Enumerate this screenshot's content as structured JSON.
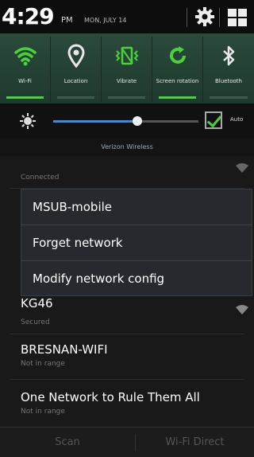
{
  "status": {
    "time": "4:29",
    "ampm": "PM",
    "date": "MON, JULY 14"
  },
  "toggles": [
    {
      "label": "Wi-Fi",
      "icon": "wifi-icon",
      "on": true
    },
    {
      "label": "Location",
      "icon": "location-icon",
      "on": false
    },
    {
      "label": "Vibrate",
      "icon": "vibrate-icon",
      "on": false
    },
    {
      "label": "Screen rotation",
      "icon": "rotation-icon",
      "on": true
    },
    {
      "label": "Bluetooth",
      "icon": "bluetooth-icon",
      "on": false
    }
  ],
  "brightness": {
    "level": 0.58,
    "auto_label": "Auto",
    "auto_checked": true
  },
  "carrier": "Verizon Wireless",
  "networks": [
    {
      "name": "",
      "status": "Connected"
    },
    {
      "name": "KG46",
      "status": "Secured"
    },
    {
      "name": "BRESNAN-WIFI",
      "status": "Not in range"
    },
    {
      "name": "One Network to Rule Them All",
      "status": "Not in range"
    }
  ],
  "menu": {
    "title": "MSUB-mobile",
    "items": [
      "Forget network",
      "Modify network config"
    ]
  },
  "bottom": {
    "scan_label": "Scan",
    "direct_label": "Wi-Fi Direct"
  },
  "colors": {
    "accent_green": "#4ad23a",
    "accent_blue": "#3a8ce0",
    "toggle_bg": "#2a4a3a"
  }
}
